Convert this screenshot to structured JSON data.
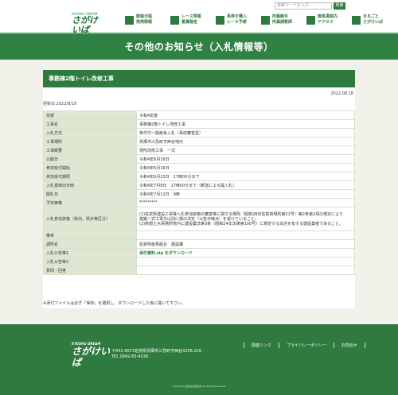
{
  "header": {
    "logo_sub": "KYUSHU DREAM",
    "logo_main": "さがけいば",
    "search_placeholder": "検索ワードを入力",
    "search_button": "検索",
    "nav": [
      {
        "line1": "開催日程",
        "line2": "発売情報",
        "icon": "calendar-icon"
      },
      {
        "line1": "レース情報",
        "line2": "重賞競走",
        "icon": "horse-icon"
      },
      {
        "line1": "馬券を購入",
        "line2": "レース予想",
        "icon": "ticket-icon"
      },
      {
        "line1": "所属騎手",
        "line2": "所属調教師",
        "icon": "jockey-icon"
      },
      {
        "line1": "競馬場案内",
        "line2": "アクセス",
        "icon": "map-icon"
      },
      {
        "line1": "まるごと",
        "line2": "さがけいば",
        "icon": "info-icon"
      }
    ]
  },
  "banner": {
    "title": "その他のお知らせ（入札情報等）"
  },
  "article": {
    "title": "事務棟2階トイレ改修工事",
    "date": "2022.08.18",
    "updated": "更新日:2022/8/18",
    "rows": [
      {
        "key": "年度",
        "value": "令和4年度"
      },
      {
        "key": "工事名",
        "value": "事務棟2階トイレ改修工事"
      },
      {
        "key": "入札方式",
        "value": "条件付一般競争入札（事前審査型）"
      },
      {
        "key": "工事場所",
        "value": "鳥栖市江島町字西谷地内"
      },
      {
        "key": "工事概要",
        "value": "便所改修工事　一式"
      },
      {
        "key": "公開日",
        "value": "令和4年6月16日"
      },
      {
        "key": "参加受付開始",
        "value": "令和4年6月16日"
      },
      {
        "key": "参加受付期限",
        "value": "令和4年6月23日　17時00分まで"
      },
      {
        "key": "入札書締切日時",
        "value": "令和4年7月8日　17時00分まで（郵送による提入札）"
      },
      {
        "key": "開札日",
        "value": "令和4年7月11日　9時"
      },
      {
        "key": "予定価格",
        "value": "*********"
      }
    ],
    "qualification_key": "入札参加資格（県内、県外等区分）",
    "qualification_lines": [
      "(1)佐賀県建設工事等入札参加資格の審査等に関する規則（昭和28年佐賀県規則第21号）第2条第2項の規定により",
      "建築一式工事又は別に掲の決定（公告日時点）を受けていること。",
      "(2)県部土木事務所管内に建設業法第3条（昭和24年法律第100号）に規定する本店を有する建設業者であること。"
    ],
    "rows2": [
      {
        "key": "備考",
        "value": ""
      },
      {
        "key": "調所名",
        "value": "佐賀県競馬組合　施設課"
      }
    ],
    "notice1_key": "入札公告等1",
    "notice1_link": "添付資料.zip をダウンロード",
    "rows3": [
      {
        "key": "入札公告等2",
        "value": ""
      },
      {
        "key": "質問・回答",
        "value": ""
      }
    ],
    "note": "※添付ファイルは必ず「保存」を選択し、ダウンロードした後に開いて下さい。"
  },
  "footer": {
    "logo_sub": "KYUSHU DREAM",
    "logo_main": "さがけいば",
    "address": "〒841-0073佐賀県鳥栖市江島町字西谷3256-226",
    "tel": "TEL 0942-83-4538",
    "links": [
      "関連リンク",
      "プライバシーポリシー",
      "お問合せ"
    ],
    "copyright": "Copyright 佐賀県競馬組合 All Rights Reserved"
  }
}
